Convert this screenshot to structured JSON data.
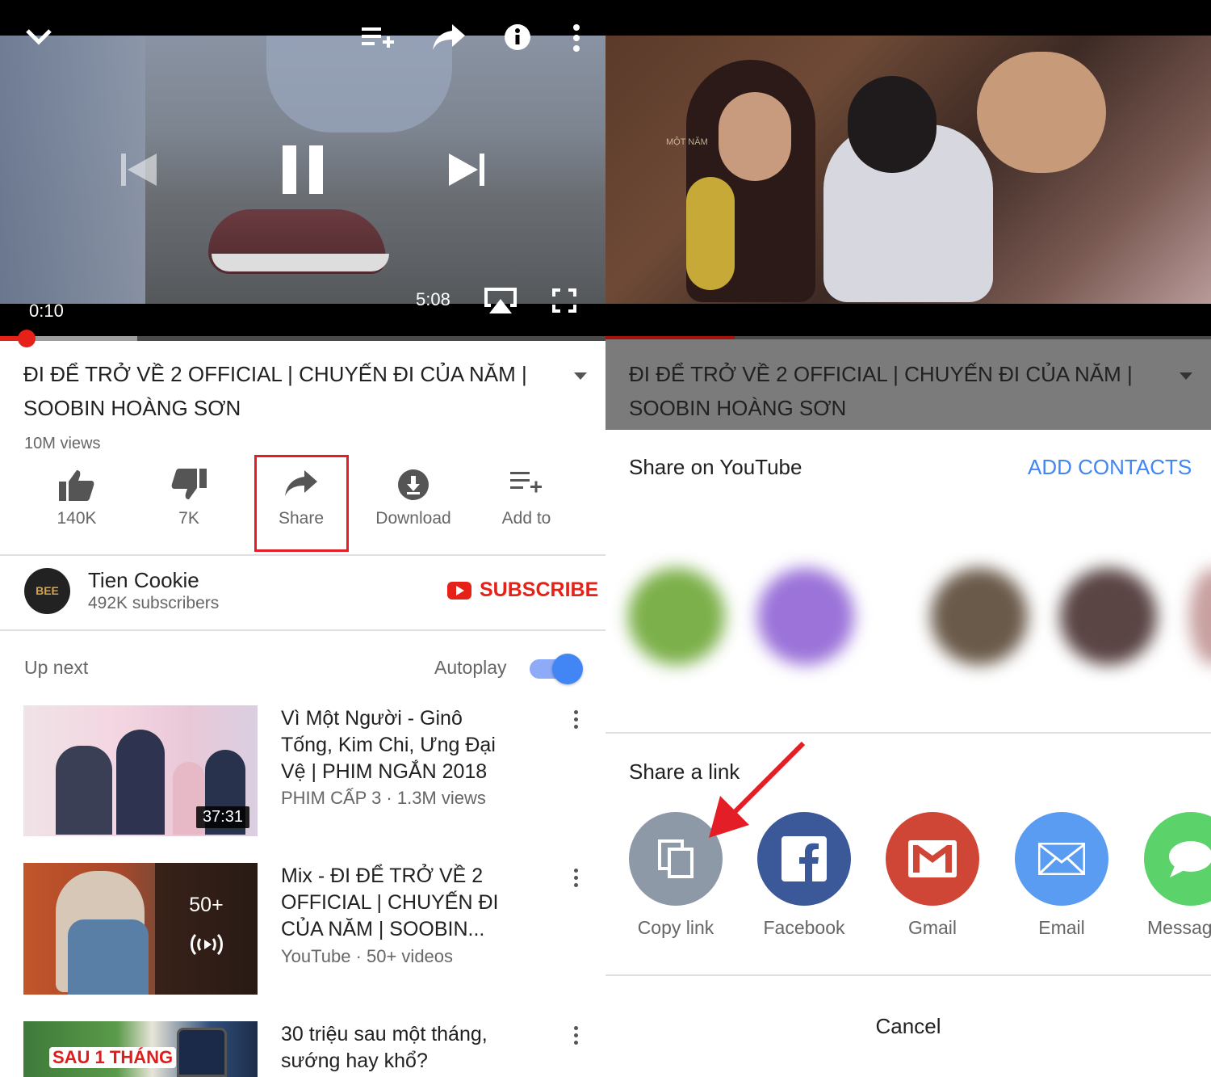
{
  "left": {
    "player": {
      "current_time": "0:10",
      "duration": "5:08",
      "progress_fraction": 0.033,
      "buffered_fraction": 0.23
    },
    "video": {
      "title_line1": "ĐI ĐỂ TRỞ VỀ 2 OFFICIAL | CHUYẾN ĐI CỦA NĂM |",
      "title_line2": "SOOBIN HOÀNG SƠN",
      "views": "10M views"
    },
    "actions": {
      "like": "140K",
      "dislike": "7K",
      "share": "Share",
      "download": "Download",
      "add_to": "Add to"
    },
    "channel": {
      "name": "Tien Cookie",
      "subscribers": "492K subscribers",
      "subscribe_label": "SUBSCRIBE"
    },
    "up_next": {
      "label": "Up next",
      "autoplay_label": "Autoplay",
      "autoplay_on": true,
      "items": [
        {
          "title_lines": [
            "Vì Một Người - Ginô",
            "Tống, Kim Chi, Ưng Đại",
            "Vệ | PHIM NGẮN 2018"
          ],
          "meta": "PHIM CẤP 3 · 1.3M views",
          "duration": "37:31"
        },
        {
          "title_lines": [
            "Mix - ĐI ĐỂ TRỞ VỀ 2",
            "OFFICIAL | CHUYẾN ĐI",
            "CỦA NĂM | SOOBIN..."
          ],
          "meta": "YouTube · 50+ videos",
          "badge": "50+"
        },
        {
          "title_lines": [
            "30 triệu sau một tháng,",
            "sướng hay khổ?"
          ],
          "thumb_text": "SAU 1 THÁNG"
        }
      ]
    }
  },
  "right": {
    "video": {
      "title_line1": "ĐI ĐỂ TRỞ VỀ 2 OFFICIAL | CHUYẾN ĐI CỦA NĂM |",
      "title_line2": "SOOBIN HOÀNG SƠN"
    },
    "share_sheet": {
      "share_on_youtube": "Share on YouTube",
      "add_contacts": "ADD CONTACTS",
      "share_a_link": "Share a link",
      "apps": [
        {
          "label": "Copy link",
          "color": "#8e99a8",
          "icon": "copy-icon"
        },
        {
          "label": "Facebook",
          "color": "#3b5998",
          "icon": "facebook-icon"
        },
        {
          "label": "Gmail",
          "color": "#d04636",
          "icon": "gmail-icon"
        },
        {
          "label": "Email",
          "color": "#5a9cf2",
          "icon": "email-icon"
        },
        {
          "label": "Messag",
          "color": "#5bd36a",
          "icon": "message-icon"
        }
      ],
      "cancel": "Cancel"
    }
  },
  "colors": {
    "accent_red": "#e62117",
    "link_blue": "#4285f4",
    "highlight_box": "#e41e26"
  }
}
